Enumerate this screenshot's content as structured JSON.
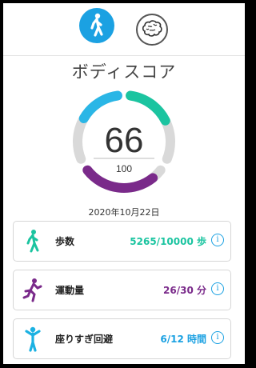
{
  "colors": {
    "accent_blue": "#1ba1e2",
    "steps_green": "#1bc4a0",
    "exercise_purple": "#7a2a8a",
    "sitting_blue": "#1bb1e2",
    "track_gray": "#d9d9d9"
  },
  "tabs": [
    {
      "icon": "walking-person-icon",
      "active": true
    },
    {
      "icon": "brain-icon",
      "active": false
    }
  ],
  "title": "ボディスコア",
  "score": {
    "value": "66",
    "max": "100"
  },
  "ring_segments": [
    {
      "name": "steps",
      "color": "#1bc4a0",
      "fraction": 0.53
    },
    {
      "name": "exercise",
      "color": "#7a2a8a",
      "fraction": 0.87
    },
    {
      "name": "sitting",
      "color": "#2ab6e6",
      "fraction": 0.5
    }
  ],
  "date": "2020年10月22日",
  "metrics": [
    {
      "icon": "walking-person-icon",
      "label": "歩数",
      "value": "5265/10000 歩",
      "color": "#1bc4a0"
    },
    {
      "icon": "running-person-icon",
      "label": "運動量",
      "value": "26/30 分",
      "color": "#7a2a8a"
    },
    {
      "icon": "standing-person-icon",
      "label": "座りすぎ回避",
      "value": "6/12 時間",
      "color": "#1ba1e2"
    }
  ],
  "info_glyph": "i"
}
